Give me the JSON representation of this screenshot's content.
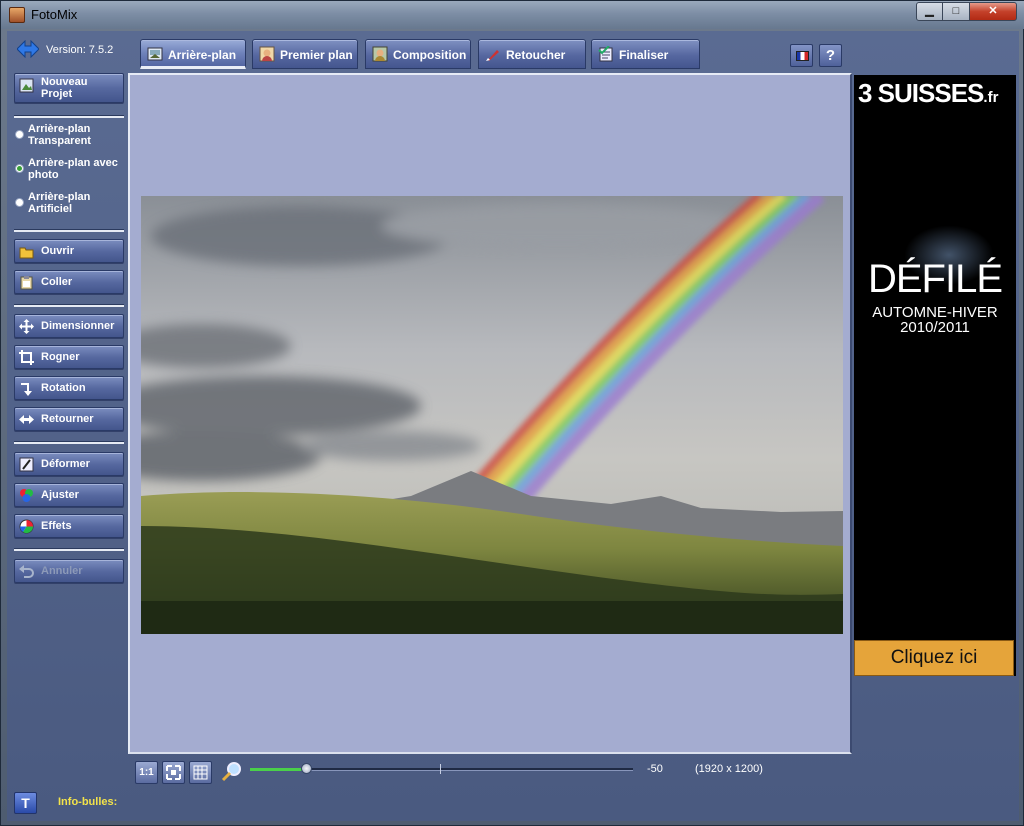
{
  "window": {
    "title": "FotoMix"
  },
  "app": {
    "version": "Version: 7.5.2"
  },
  "sidebar": {
    "new_project": "Nouveau Projet",
    "background_options": [
      {
        "label": "Arrière-plan Transparent",
        "selected": false
      },
      {
        "label": "Arrière-plan avec photo",
        "selected": true
      },
      {
        "label": "Arrière-plan Artificiel",
        "selected": false
      }
    ],
    "open": "Ouvrir",
    "paste": "Coller",
    "resize": "Dimensionner",
    "crop": "Rogner",
    "rotate": "Rotation",
    "flip": "Retourner",
    "deform": "Déformer",
    "adjust": "Ajuster",
    "effects": "Effets",
    "undo": "Annuler"
  },
  "tabs": [
    {
      "label": "Arrière-plan",
      "active": true
    },
    {
      "label": "Premier plan",
      "active": false
    },
    {
      "label": "Composition",
      "active": false
    },
    {
      "label": "Retoucher",
      "active": false
    },
    {
      "label": "Finaliser",
      "active": false
    }
  ],
  "header": {
    "help_label": "?"
  },
  "bottom": {
    "actual_size_label": "1:1",
    "zoom_value": "-50",
    "zoom_fraction": 0.15,
    "image_dimensions": "(1920 x 1200)",
    "tooltip_button": "T",
    "tooltip_label": "Info-bulles:"
  },
  "ad": {
    "logo_main": "3 SUISSES",
    "logo_suffix": ".fr",
    "headline": "DÉFILÉ",
    "sub_line1": "AUTOMNE-HIVER",
    "sub_line2": "2010/2011",
    "cta": "Cliquez ici"
  }
}
